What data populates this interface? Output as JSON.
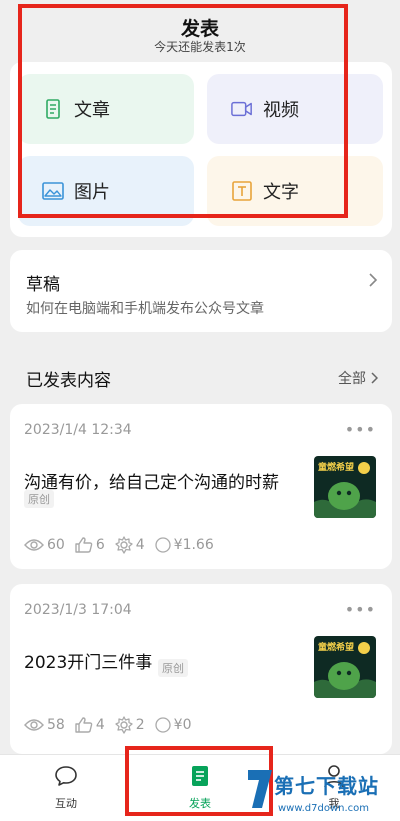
{
  "header": {
    "title": "发表",
    "subtitle": "今天还能发表1次"
  },
  "publish_options": [
    {
      "label": "文章",
      "icon": "article-icon",
      "color": "#2faa63"
    },
    {
      "label": "视频",
      "icon": "video-icon",
      "color": "#6b6fd6"
    },
    {
      "label": "图片",
      "icon": "image-icon",
      "color": "#3a93d8"
    },
    {
      "label": "文字",
      "icon": "text-icon",
      "color": "#e8a33a"
    }
  ],
  "drafts": {
    "title": "草稿",
    "subtitle": "如何在电脑端和手机端发布公众号文章"
  },
  "published": {
    "title": "已发表内容",
    "all_label": "全部"
  },
  "posts": [
    {
      "date": "2023/1/4 12:34",
      "title": "沟通有价，给自己定个沟通的时薪",
      "badge": "原创",
      "views": "60",
      "likes": "6",
      "shares": "4",
      "earnings": "¥1.66",
      "thumb_text": "童燃希望"
    },
    {
      "date": "2023/1/3 17:04",
      "title": "2023开门三件事",
      "badge": "原创",
      "views": "58",
      "likes": "4",
      "shares": "2",
      "earnings": "¥0",
      "thumb_text": "童燃希望"
    }
  ],
  "tabbar": {
    "interact": "互动",
    "publish": "发表",
    "me": "我"
  },
  "watermark": {
    "main": "第七下载站",
    "sub": "www.d7down.com"
  },
  "colors": {
    "accent_green": "#07a35a",
    "annotation_red": "#e6251b",
    "watermark_blue": "#1a6fb5"
  }
}
